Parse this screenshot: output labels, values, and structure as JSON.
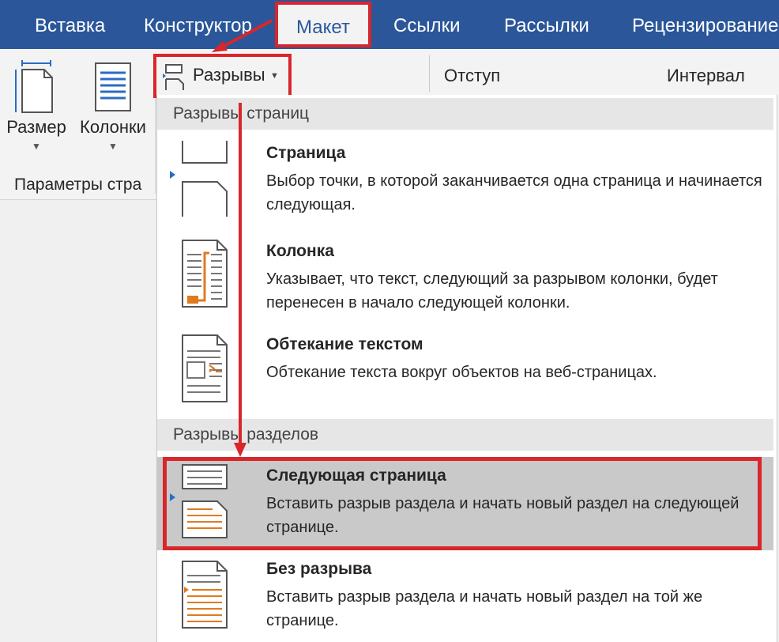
{
  "tabs": [
    "Вставка",
    "Конструктор",
    "Макет",
    "Ссылки",
    "Рассылки",
    "Рецензирование"
  ],
  "active_tab": "Макет",
  "ribbon": {
    "size_label": "Размер",
    "columns_label": "Колонки",
    "breaks_label": "Разрывы",
    "indent_label": "Отступ",
    "spacing_label": "Интервал",
    "group_label": "Параметры стра"
  },
  "menu": {
    "page_breaks_header": "Разрывы страниц",
    "section_breaks_header": "Разрывы разделов",
    "items": [
      {
        "title": "Страница",
        "desc": "Выбор точки, в которой заканчивается одна страница и начинается следующая."
      },
      {
        "title": "Колонка",
        "desc": "Указывает, что текст, следующий за разрывом колонки, будет перенесен в начало следующей колонки."
      },
      {
        "title": "Обтекание текстом",
        "desc": "Обтекание текста вокруг объектов на веб-страницах."
      },
      {
        "title": "Следующая страница",
        "desc": "Вставить разрыв раздела и начать новый раздел на следующей странице."
      },
      {
        "title": "Без разрыва",
        "desc": "Вставить разрыв раздела и начать новый раздел на той же странице."
      }
    ]
  },
  "colors": {
    "tab_bar": "#2b579a",
    "highlight_border": "#d8262b",
    "selected_item": "#c9c9c9"
  }
}
